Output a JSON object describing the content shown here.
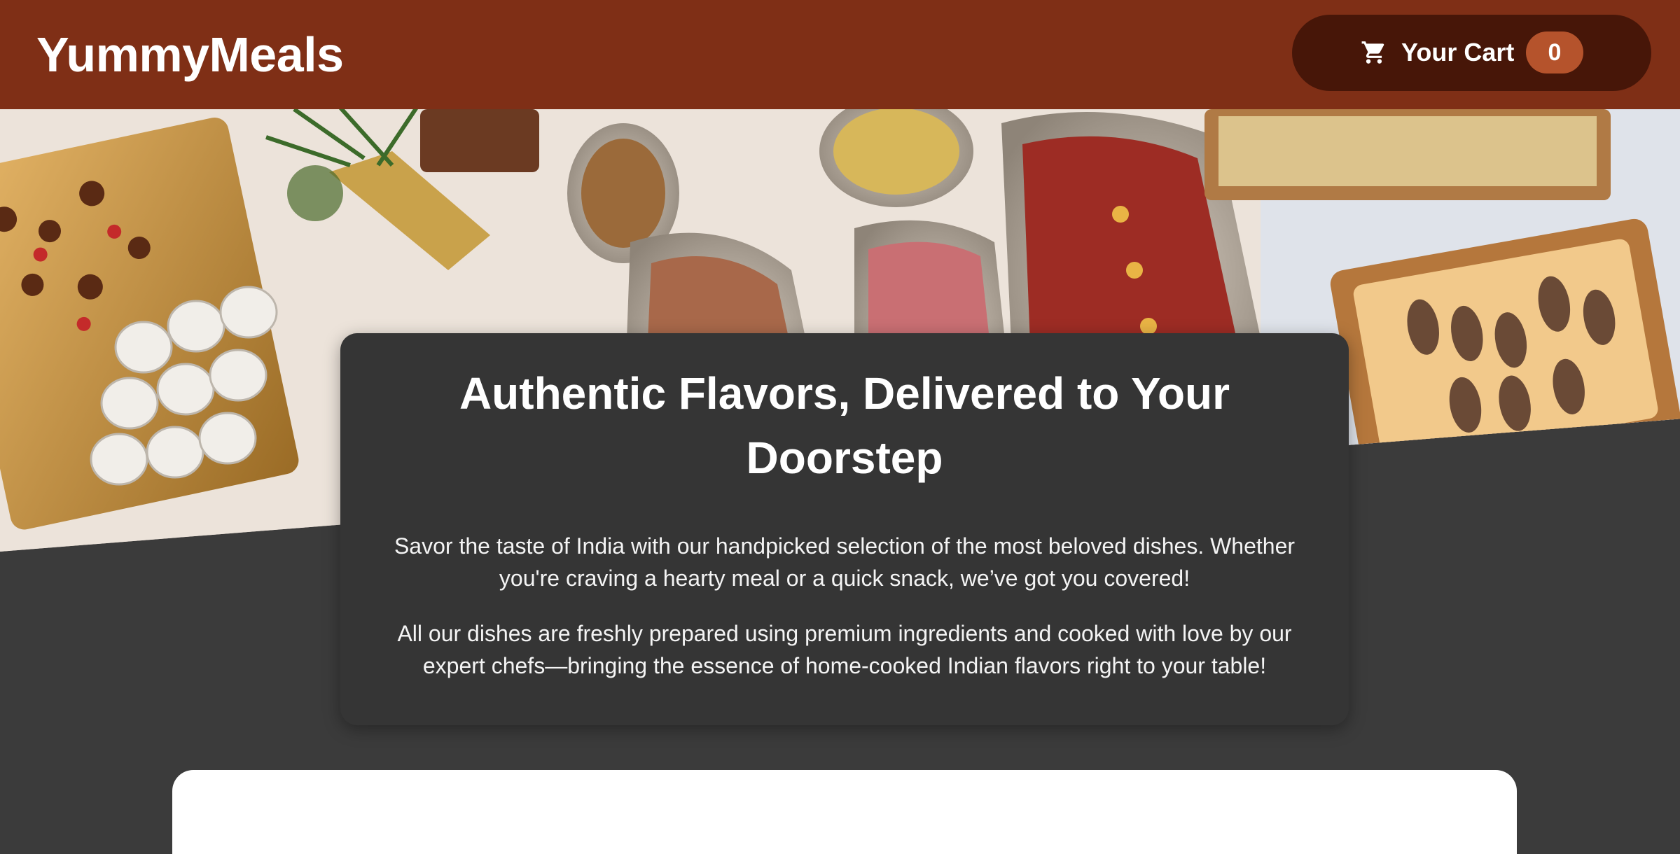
{
  "header": {
    "brand": "YummyMeals",
    "cart_label": "Your Cart",
    "cart_count": "0",
    "cart_icon": "shopping-cart-icon"
  },
  "hero": {
    "image": "buffet-table-photo"
  },
  "intro": {
    "title": "Authentic Flavors, Delivered to Your Doorstep",
    "paragraph_1": "Savor the taste of India with our handpicked selection of the most beloved dishes. Whether you're craving a hearty meal or a quick snack, we’ve got you covered!",
    "paragraph_2": "All our dishes are freshly prepared using premium ingredients and cooked with love by our expert chefs—bringing the essence of home-cooked Indian flavors right to your table!"
  },
  "colors": {
    "header_bg": "#7f2f16",
    "cart_bg": "#471608",
    "badge_bg": "#b5532c",
    "page_bg": "#3b3b3b",
    "card_bg": "#353535"
  }
}
